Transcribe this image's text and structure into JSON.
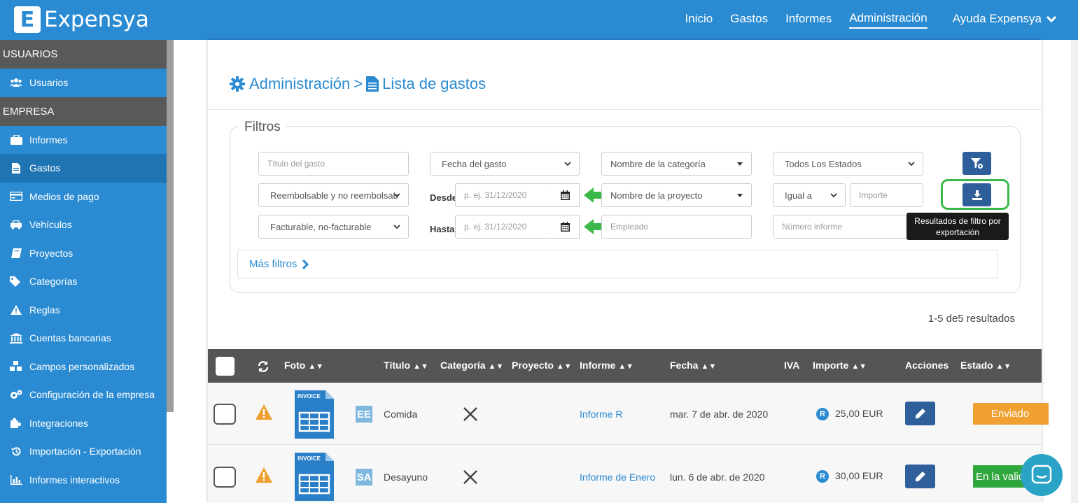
{
  "app": {
    "logo_letter": "E",
    "logo_text": "Expensya"
  },
  "nav": {
    "items": [
      "Inicio",
      "Gastos",
      "Informes",
      "Administración"
    ],
    "active": "Administración",
    "help": "Ayuda Expensya"
  },
  "sidebar": {
    "section_users": "USUARIOS",
    "users_item": "Usuarios",
    "section_company": "EMPRESA",
    "items": [
      "Informes",
      "Gastos",
      "Medios de pago",
      "Vehículos",
      "Proyectos",
      "Categorías",
      "Reglas",
      "Cuentas bancarias",
      "Campos personalizados",
      "Configuración de la empresa",
      "Integraciones",
      "Importación - Exportación",
      "Informes interactivos"
    ],
    "active": "Gastos"
  },
  "breadcrumb": {
    "root": "Administración",
    "separator": ">",
    "current": "Lista de gastos"
  },
  "filters": {
    "legend": "Filtros",
    "titulo_placeholder": "Título del gasto",
    "fecha_select": "Fecha del gasto",
    "categoria_select": "Nombre de la categoría",
    "estados_select": "Todos Los Estados",
    "reembolsable_select": "Reembolsable y no reembolsab",
    "desde_label": "Desde",
    "desde_placeholder": "p. ej. 31/12/2020",
    "proyecto_select": "Nombre de la proyecto",
    "igual_select": "Igual a",
    "importe_placeholder": "Importe",
    "facturable_select": "Facturable, no-facturable",
    "hasta_label": "Hasta",
    "hasta_placeholder": "p. ej. 31/12/2020",
    "empleado_placeholder": "Empleado",
    "numero_placeholder": "Número informe",
    "tooltip": "Resultados de filtro por exportación",
    "mas_filtros": "Más filtros"
  },
  "results_text": "1-5 de5 resultados",
  "table": {
    "headers": [
      "Foto",
      "Título",
      "Categoría",
      "Proyecto",
      "Informe",
      "Fecha",
      "IVA",
      "Importe",
      "Acciones",
      "Estado"
    ],
    "rows": [
      {
        "badge": "EE",
        "titulo": "Comida",
        "informe": "Informe R",
        "fecha": "mar. 7 de abr. de 2020",
        "importe": "25,00 EUR",
        "estado": "Enviado",
        "estado_color": "#f0a030"
      },
      {
        "badge": "SA",
        "titulo": "Desayuno",
        "informe": "Informe de Enero",
        "fecha": "lun. 6 de abr. de 2020",
        "importe": "30,00 EUR",
        "estado": "En la valid",
        "estado_color": "#2fa73c"
      }
    ],
    "invoice_label": "INVOICE",
    "currency_icon": "R"
  },
  "colors": {
    "brand": "#2a8bd2",
    "accent_button": "#2f5f9a",
    "highlight": "#3bb84a"
  }
}
